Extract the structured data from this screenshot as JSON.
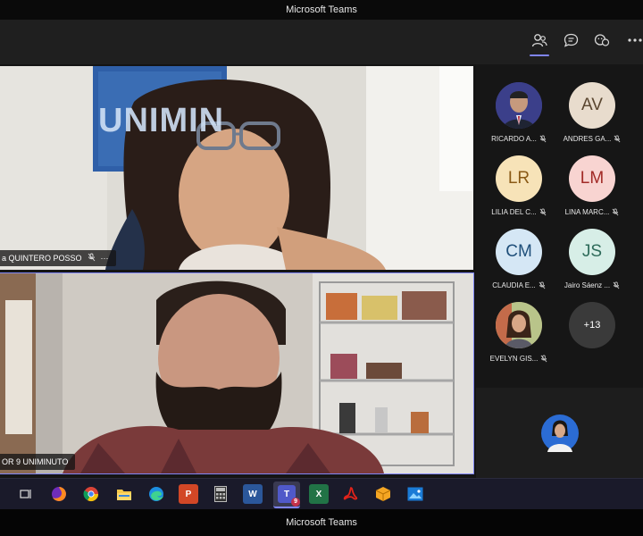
{
  "window": {
    "title": "Microsoft Teams",
    "bottom_title": "Microsoft Teams"
  },
  "toolbar": {
    "buttons": [
      {
        "name": "people-icon",
        "active": true
      },
      {
        "name": "chat-icon",
        "active": false
      },
      {
        "name": "reactions-icon",
        "active": false
      },
      {
        "name": "more-options-icon",
        "active": false
      }
    ]
  },
  "stage": {
    "top_video": {
      "name": "a QUINTERO POSSO",
      "background_sign": "UNIMIN",
      "more_glyph": "···"
    },
    "bottom_video": {
      "name": "OR 9 UNIMINUTO"
    }
  },
  "gallery": {
    "participants": [
      {
        "initials": "",
        "name": "RICARDO A...",
        "photo": true,
        "bg": "#3b3f8a"
      },
      {
        "initials": "AV",
        "name": "ANDRES GA...",
        "bg": "#e8dccd",
        "fg": "#5a4630"
      },
      {
        "initials": "LR",
        "name": "LILIA DEL C...",
        "bg": "#f7e3b8",
        "fg": "#8a5a16"
      },
      {
        "initials": "LM",
        "name": "LINA MARC...",
        "bg": "#f8d4d1",
        "fg": "#a12a26"
      },
      {
        "initials": "CM",
        "name": "CLAUDIA E...",
        "bg": "#d5e7f5",
        "fg": "#1f4f7a"
      },
      {
        "initials": "JS",
        "name": "Jairo Sáenz ...",
        "bg": "#d7eee7",
        "fg": "#2e6b5a"
      },
      {
        "initials": "",
        "name": "EVELYN GIS...",
        "photo": true,
        "bg": "#8a6a4f"
      }
    ],
    "overflow": "+13"
  },
  "taskbar": {
    "apps": [
      {
        "name": "task-view-icon",
        "label": ""
      },
      {
        "name": "firefox-icon",
        "label": ""
      },
      {
        "name": "chrome-icon",
        "label": ""
      },
      {
        "name": "file-explorer-icon",
        "label": ""
      },
      {
        "name": "edge-icon",
        "label": ""
      },
      {
        "name": "powerpoint-icon",
        "label": "P"
      },
      {
        "name": "calculator-icon",
        "label": ""
      },
      {
        "name": "word-icon",
        "label": "W"
      },
      {
        "name": "teams-icon",
        "label": "T",
        "badge": "9"
      },
      {
        "name": "excel-icon",
        "label": "X"
      },
      {
        "name": "acrobat-icon",
        "label": ""
      },
      {
        "name": "package-icon",
        "label": ""
      },
      {
        "name": "photos-icon",
        "label": ""
      }
    ]
  }
}
